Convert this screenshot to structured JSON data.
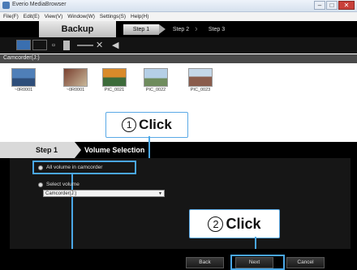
{
  "window": {
    "title": "Everio MediaBrowser",
    "minimize": "–",
    "maximize": "□",
    "close": "✕"
  },
  "menu": [
    "File(F)",
    "Edit(E)",
    "View(V)",
    "Window(W)",
    "Settings(S)",
    "Help(H)"
  ],
  "header": {
    "title": "Backup",
    "steps": [
      "Step 1",
      "Step 2",
      "Step 3"
    ]
  },
  "toolbar": {
    "icons": [
      "grid-view-icon",
      "list-view-icon",
      "zoom-slider",
      "fit-icon",
      "audio-icon"
    ]
  },
  "source": {
    "label": "Camcorder(J:)"
  },
  "thumbnails": [
    {
      "caption": "~0R0001",
      "colors": [
        "#3b6aa8",
        "#7a4b2a"
      ]
    },
    {
      "caption": "~0R0001",
      "colors": [
        "#6e3a2a",
        "#a8a08a"
      ]
    },
    {
      "caption": "PIC_0021",
      "colors": [
        "#c97a2a",
        "#3a6a3a"
      ]
    },
    {
      "caption": "PIC_0022",
      "colors": [
        "#a6c3df",
        "#6a8a5a"
      ]
    },
    {
      "caption": "PIC_0023",
      "colors": [
        "#b8cde0",
        "#8a5a4a"
      ]
    }
  ],
  "callouts": [
    {
      "number": "1",
      "text": "Click"
    },
    {
      "number": "2",
      "text": "Click"
    }
  ],
  "stepbar": {
    "step": "Step 1",
    "title": "Volume Selection"
  },
  "options": {
    "all_volume": "All volume in camcorder",
    "select_volume": "Select volume",
    "select_value": "Camcorder(J:)"
  },
  "footer": {
    "back": "Back",
    "next": "Next",
    "cancel": "Cancel"
  },
  "colors": {
    "accent": "#4aa7e6",
    "selected_view": "#3a6fb0"
  }
}
